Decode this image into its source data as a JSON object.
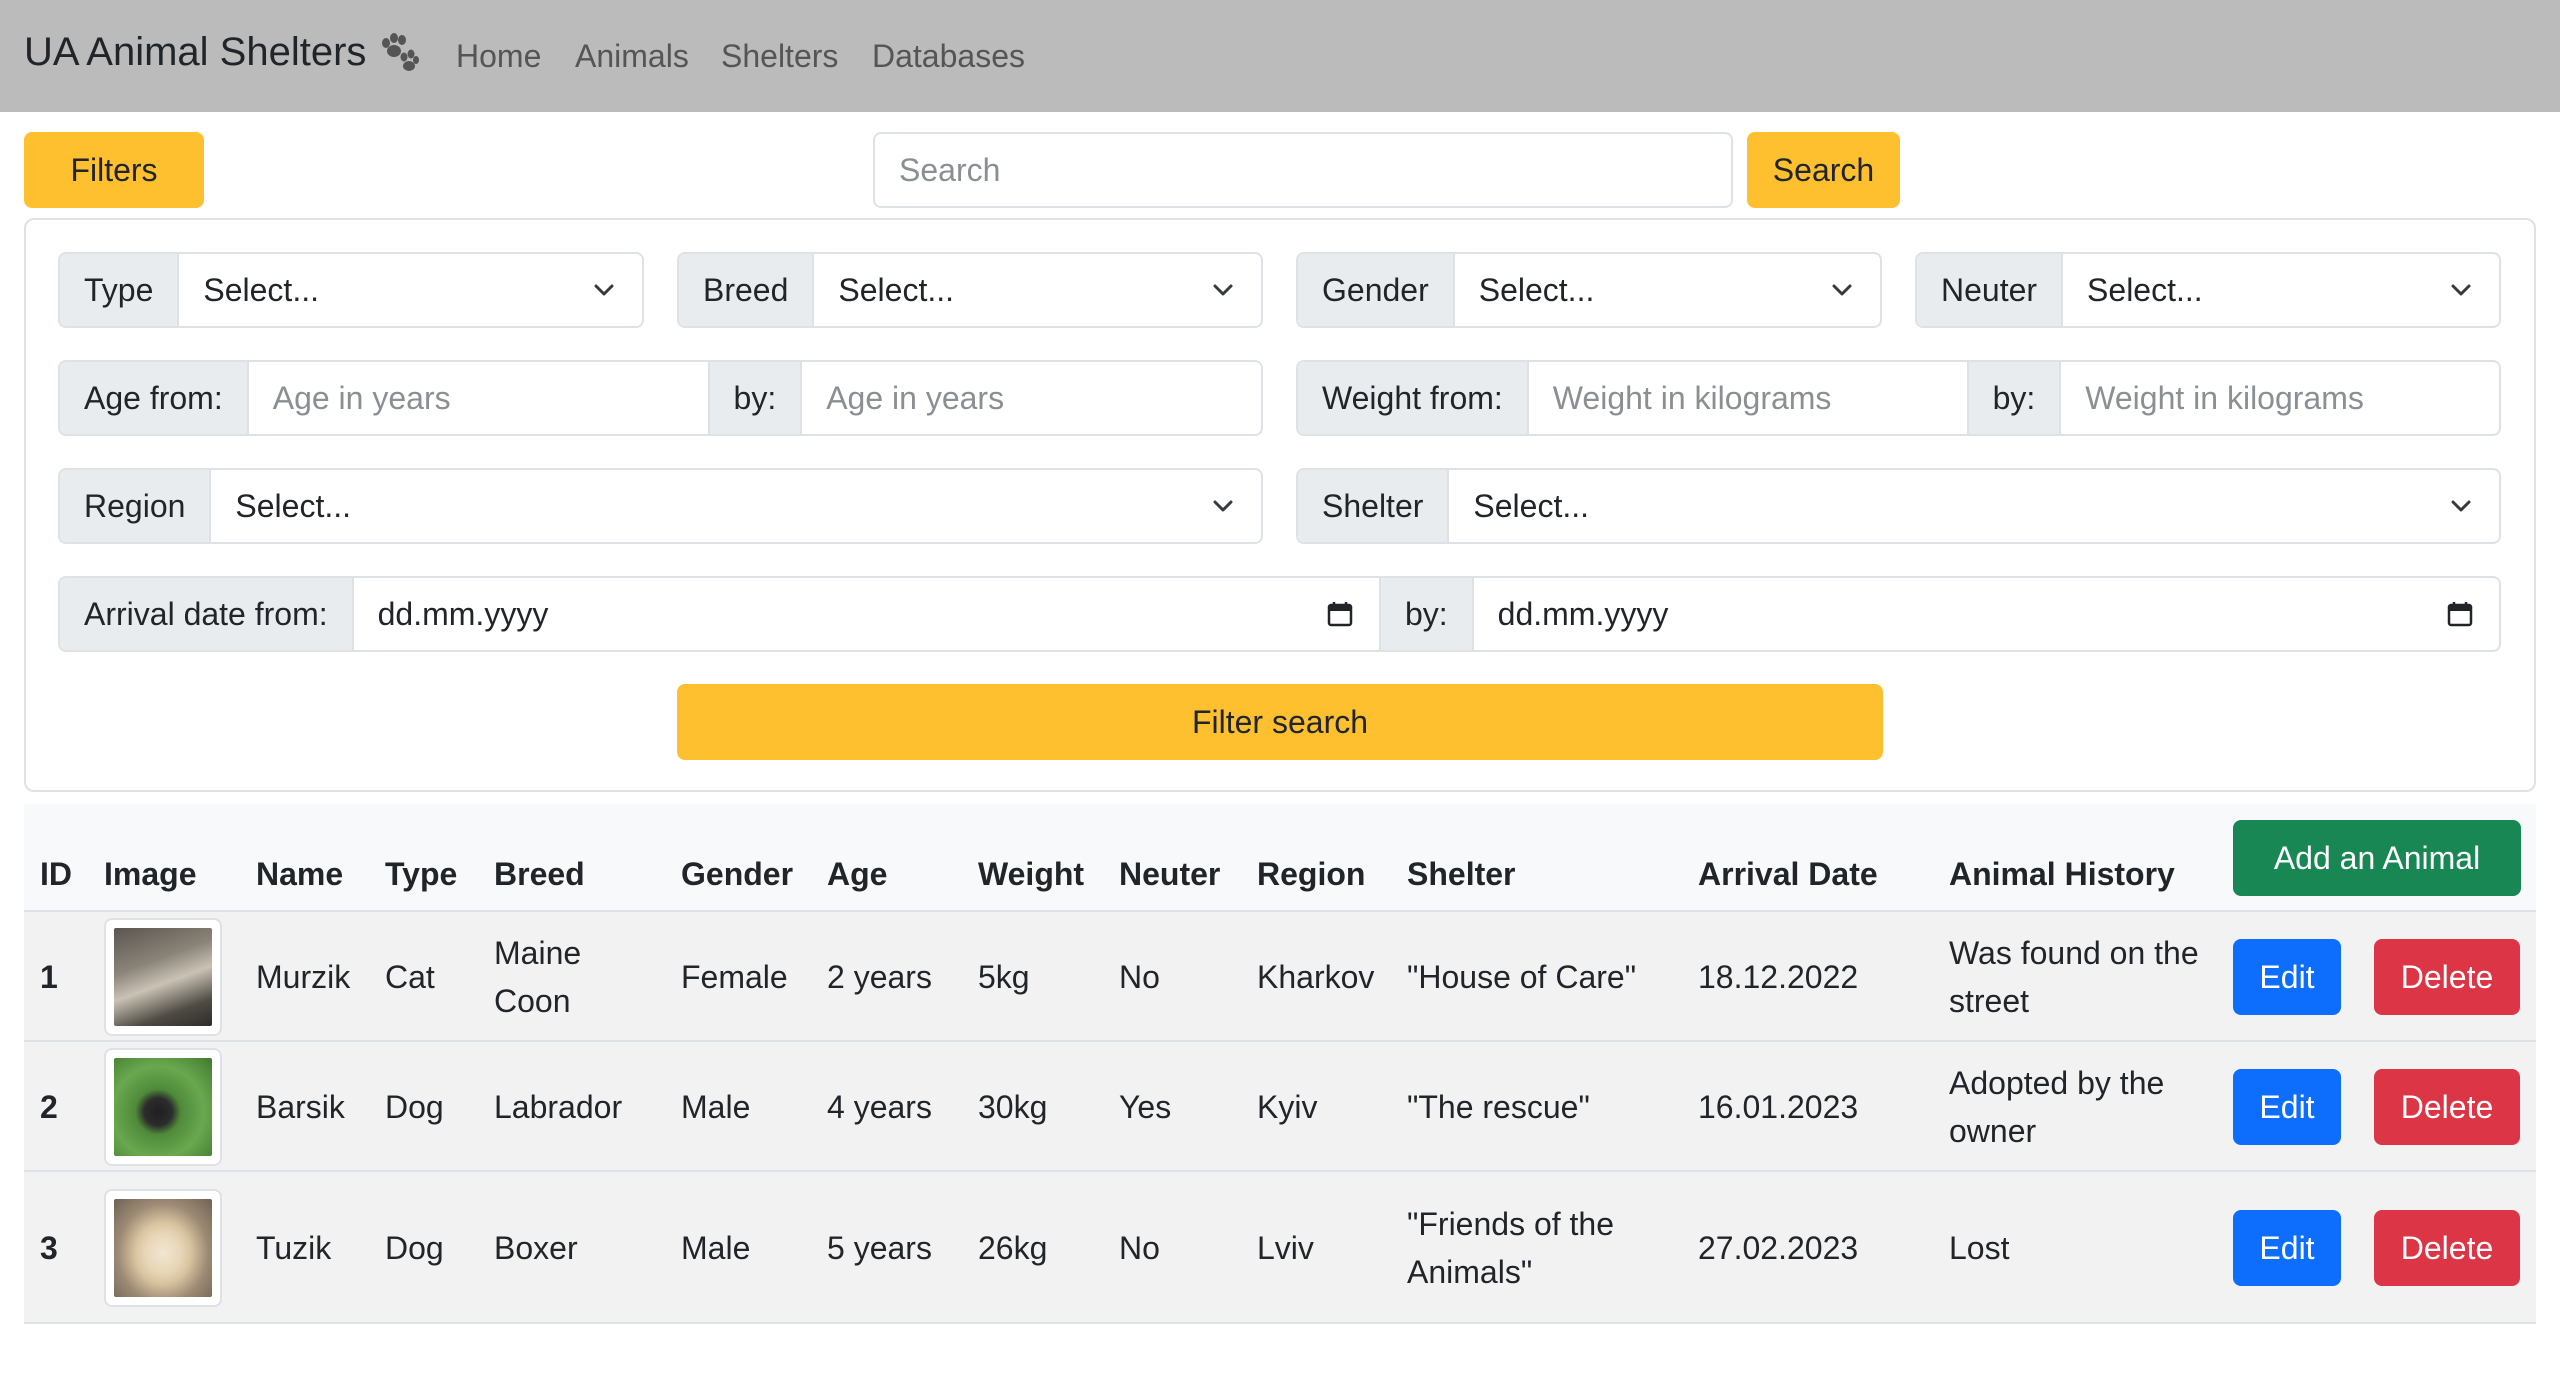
{
  "navbar": {
    "brand": "UA Animal Shelters",
    "links": [
      "Home",
      "Animals",
      "Shelters",
      "Databases"
    ]
  },
  "toolbar": {
    "filters_label": "Filters",
    "search_placeholder": "Search",
    "search_label": "Search"
  },
  "filters": {
    "type": {
      "label": "Type",
      "value": "Select..."
    },
    "breed": {
      "label": "Breed",
      "value": "Select..."
    },
    "gender": {
      "label": "Gender",
      "value": "Select..."
    },
    "neuter": {
      "label": "Neuter",
      "value": "Select..."
    },
    "age_from": {
      "label": "Age from:",
      "placeholder": "Age in years"
    },
    "age_by": {
      "label": "by:",
      "placeholder": "Age in years"
    },
    "weight_from": {
      "label": "Weight from:",
      "placeholder": "Weight in kilograms"
    },
    "weight_by": {
      "label": "by:",
      "placeholder": "Weight in kilograms"
    },
    "region": {
      "label": "Region",
      "value": "Select..."
    },
    "shelter": {
      "label": "Shelter",
      "value": "Select..."
    },
    "arrival_from": {
      "label": "Arrival date from:",
      "value": "dd.mm.yyyy"
    },
    "arrival_by": {
      "label": "by:",
      "value": "dd.mm.yyyy"
    },
    "filter_search_label": "Filter search"
  },
  "table": {
    "headers": {
      "id": "ID",
      "image": "Image",
      "name": "Name",
      "type": "Type",
      "breed": "Breed",
      "gender": "Gender",
      "age": "Age",
      "weight": "Weight",
      "neuter": "Neuter",
      "region": "Region",
      "shelter": "Shelter",
      "arrival": "Arrival Date",
      "history": "Animal History"
    },
    "add_label": "Add an Animal",
    "edit_label": "Edit",
    "delete_label": "Delete",
    "rows": [
      {
        "id": "1",
        "name": "Murzik",
        "type": "Cat",
        "breed": "Maine Coon",
        "gender": "Female",
        "age": "2 years",
        "weight": "5kg",
        "neuter": "No",
        "region": "Kharkov",
        "shelter": "\"House of Care\"",
        "arrival": "18.12.2022",
        "history": "Was found on the street"
      },
      {
        "id": "2",
        "name": "Barsik",
        "type": "Dog",
        "breed": "Labrador",
        "gender": "Male",
        "age": "4 years",
        "weight": "30kg",
        "neuter": "Yes",
        "region": "Kyiv",
        "shelter": "\"The rescue\"",
        "arrival": "16.01.2023",
        "history": "Adopted by the owner"
      },
      {
        "id": "3",
        "name": "Tuzik",
        "type": "Dog",
        "breed": "Boxer",
        "gender": "Male",
        "age": "5 years",
        "weight": "26kg",
        "neuter": "No",
        "region": "Lviv",
        "shelter": "\"Friends of the Animals\"",
        "arrival": "27.02.2023",
        "history": "Lost"
      }
    ]
  },
  "colors": {
    "navbar_bg": "#bbbbbb",
    "accent_yellow": "#fec02e",
    "edit_blue": "#0d6efd",
    "delete_red": "#dc3545",
    "add_green": "#198754"
  },
  "icons": {
    "brand": "paw-icon",
    "select": "chevron-down-icon",
    "date": "calendar-icon"
  }
}
